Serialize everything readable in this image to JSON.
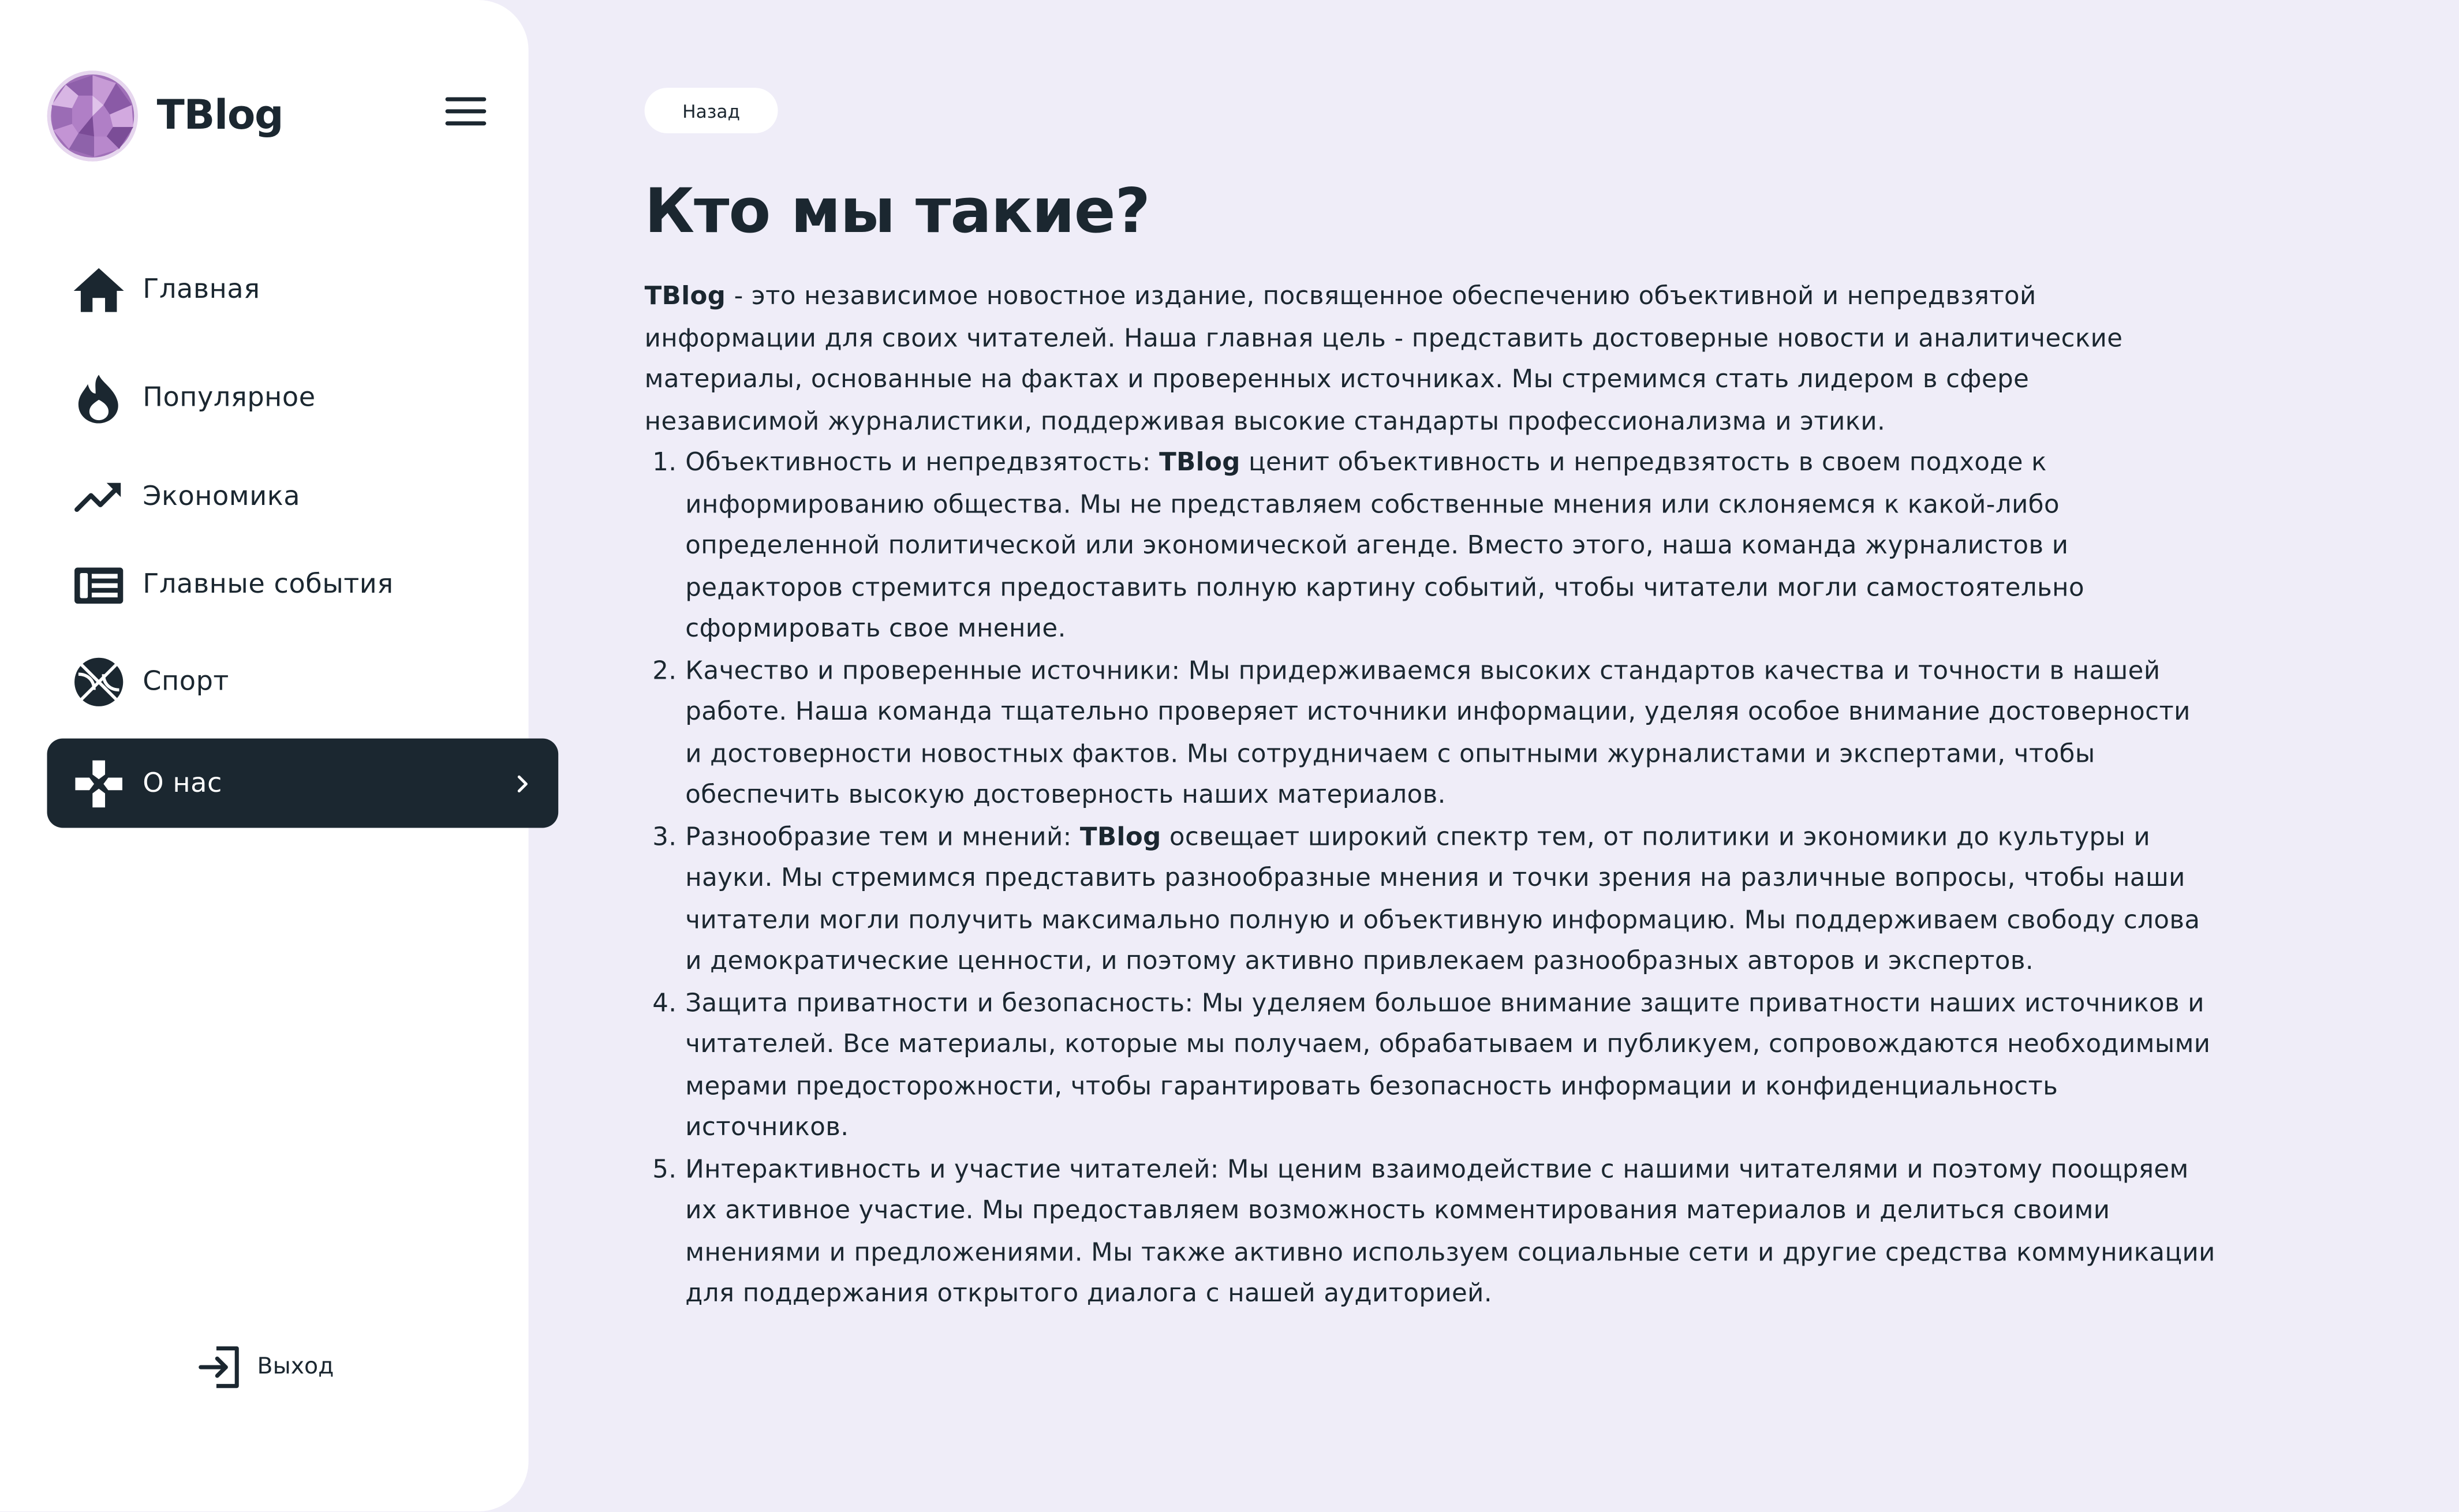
{
  "brand": {
    "name": "TBlog"
  },
  "nav": {
    "items": [
      {
        "label": "Главная",
        "icon": "home-icon"
      },
      {
        "label": "Популярное",
        "icon": "flame-icon"
      },
      {
        "label": "Экономика",
        "icon": "trending-up-icon"
      },
      {
        "label": "Главные события",
        "icon": "newspaper-icon"
      },
      {
        "label": "Спорт",
        "icon": "basketball-icon"
      },
      {
        "label": "О нас",
        "icon": "gamepad-icon",
        "active": true
      }
    ],
    "logout_label": "Выход"
  },
  "colors": {
    "page_bg": "#efedf8",
    "sidebar_bg": "#ffffff",
    "text": "#1b2730",
    "active_bg": "#1b2730",
    "active_text": "#ffffff"
  },
  "main": {
    "back_label": "Назад",
    "title": "Кто мы такие?",
    "intro": {
      "brand": "TBlog",
      "lines": [
        " - это независимое новостное издание, посвященное обеспечению объективной и непредвзятой",
        "информации для своих читателей. Наша главная цель - представить достоверные новости и аналитические",
        "материалы, основанные на фактах и проверенных источниках. Мы стремимся стать лидером в сфере",
        "независимой журналистики, поддерживая высокие стандарты профессионализма и этики."
      ]
    },
    "list": [
      {
        "num": "1.",
        "first_lead": "Объективность и непредвзятость: ",
        "first_brand": "TBlog",
        "first_rest": " ценит объективность и непредвзятость в своем подходе к",
        "lines": [
          "информированию общества. Мы не представляем собственные мнения или склоняемся к какой-либо",
          "определенной политической или экономической агенде. Вместо этого, наша команда журналистов и",
          "редакторов стремится предоставить полную картину событий, чтобы читатели могли самостоятельно",
          "сформировать свое мнение."
        ]
      },
      {
        "num": "2.",
        "first_lead": "Качество и проверенные источники: Мы придерживаемся высоких стандартов качества и точности в нашей",
        "lines": [
          "работе. Наша команда тщательно проверяет источники информации, уделяя особое внимание достоверности",
          "и достоверности новостных фактов. Мы сотрудничаем с опытными журналистами и экспертами, чтобы",
          "обеспечить высокую достоверность наших материалов."
        ]
      },
      {
        "num": "3.",
        "first_lead": "Разнообразие тем и мнений: ",
        "first_brand": "TBlog",
        "first_rest": " освещает широкий спектр тем, от политики и экономики до культуры и",
        "lines": [
          "науки. Мы стремимся представить разнообразные мнения и точки зрения на различные вопросы, чтобы наши",
          "читатели могли получить максимально полную и объективную информацию. Мы поддерживаем свободу слова",
          "и демократические ценности, и поэтому активно привлекаем разнообразных авторов и экспертов."
        ]
      },
      {
        "num": "4.",
        "first_lead": "Защита приватности и безопасность: Мы уделяем большое внимание защите приватности наших источников и",
        "lines": [
          "читателей. Все материалы, которые мы получаем, обрабатываем и публикуем, сопровождаются необходимыми",
          "мерами предосторожности, чтобы гарантировать безопасность информации и конфиденциальность",
          "источников."
        ]
      },
      {
        "num": "5.",
        "first_lead": "Интерактивность и участие читателей: Мы ценим взаимодействие с нашими читателями и поэтому поощряем",
        "lines": [
          "их активное участие. Мы предоставляем возможность комментирования материалов и делиться своими",
          "мнениями и предложениями. Мы также активно используем социальные сети и другие средства коммуникации",
          "для поддержания открытого диалога с нашей аудиторией."
        ]
      }
    ]
  }
}
